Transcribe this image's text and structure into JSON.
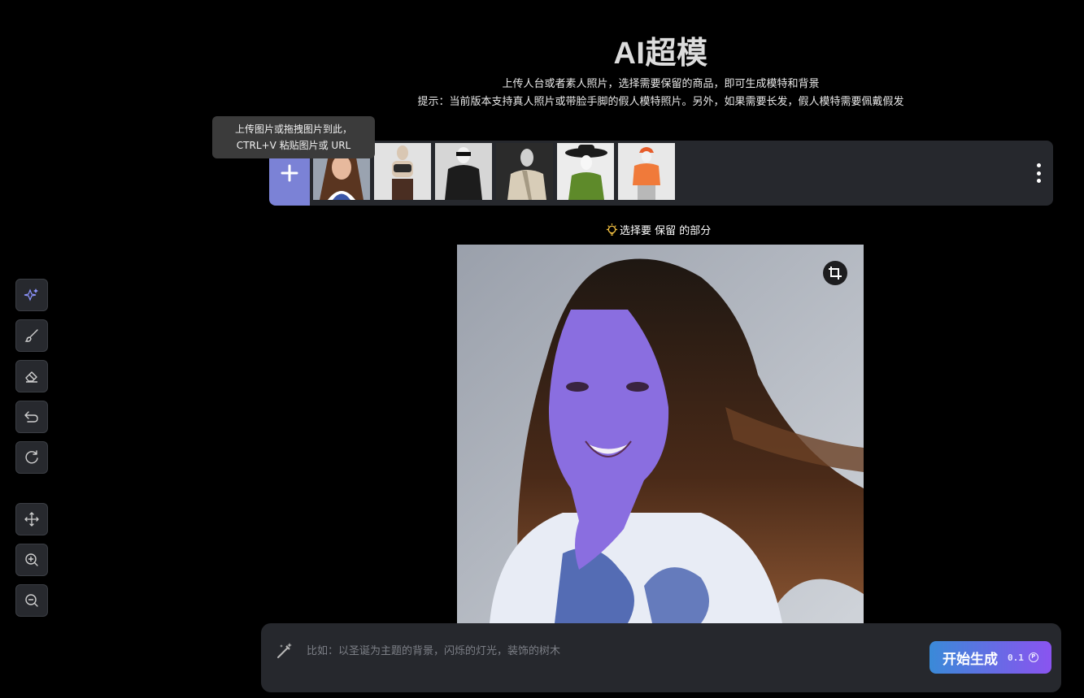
{
  "header": {
    "title": "AI超模",
    "subtitle": "上传人台或者素人照片，选择需要保留的商品，即可生成模特和背景",
    "tip": "提示：当前版本支持真人照片或带脸手脚的假人模特照片。另外，如果需要长发，假人模特需要佩戴假发"
  },
  "upload": {
    "tooltip_line1": "上传图片或拖拽图片到此，",
    "tooltip_line2": "CTRL+V 粘贴图片或 URL"
  },
  "thumbnails": [
    {
      "name": "long-hair-woman"
    },
    {
      "name": "bald-mannequin-sportswear"
    },
    {
      "name": "mannequin-sunglasses-jacket"
    },
    {
      "name": "mannequin-beige-coat"
    },
    {
      "name": "mannequin-cowboy-hat"
    },
    {
      "name": "mannequin-orange-cap"
    }
  ],
  "hint": {
    "text": "选择要 保留 的部分",
    "icon": "lightbulb-icon"
  },
  "tools": [
    {
      "name": "auto-select-icon"
    },
    {
      "name": "brush-icon"
    },
    {
      "name": "eraser-icon"
    },
    {
      "name": "undo-icon"
    },
    {
      "name": "redo-icon"
    },
    {
      "name": "move-icon"
    },
    {
      "name": "zoom-in-icon"
    },
    {
      "name": "zoom-out-icon"
    }
  ],
  "prompt": {
    "placeholder": "比如：以圣诞为主题的背景，闪烁的灯光，装饰的树木",
    "value": ""
  },
  "generate": {
    "label": "开始生成",
    "cost": "0.1",
    "coin_symbol": "P"
  },
  "colors": {
    "background": "#000000",
    "panel": "#26282d",
    "upload_accent": "#7b82d6",
    "mask": "#8a6ee0",
    "generate_gradient_start": "#3a8ad8",
    "generate_gradient_end": "#8a54f0"
  }
}
